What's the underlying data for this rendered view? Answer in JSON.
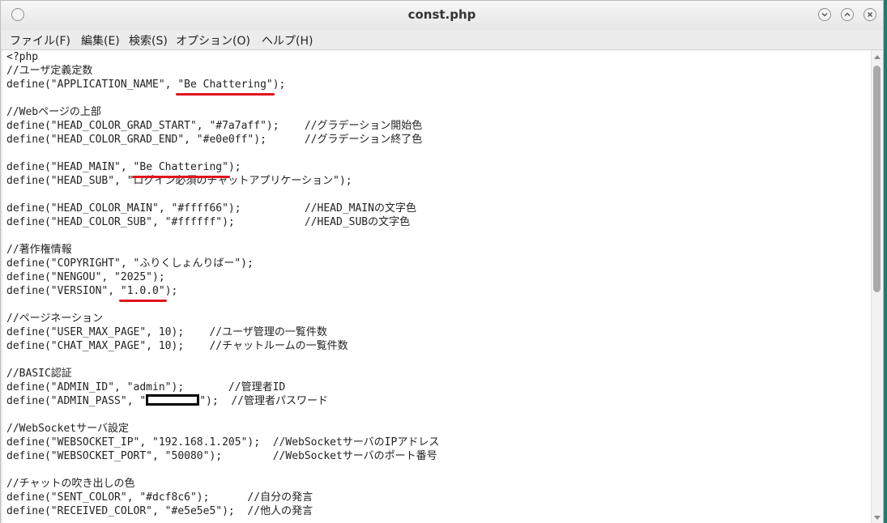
{
  "window": {
    "title": "const.php"
  },
  "menu": [
    "ファイル(F)",
    "編集(E)",
    "検索(S)",
    "オプション(O)",
    "ヘルプ(H)"
  ],
  "code_lines": [
    [
      "<?php"
    ],
    [
      "//ユーザ定義定数"
    ],
    [
      "define(\"APPLICATION_NAME\", ",
      "\"Be Chattering\"",
      ");"
    ],
    [
      ""
    ],
    [
      "//Webページの上部"
    ],
    [
      "define(\"HEAD_COLOR_GRAD_START\", \"#7a7aff\");    //グラデーション開始色"
    ],
    [
      "define(\"HEAD_COLOR_GRAD_END\", \"#e0e0ff\");      //グラデーション終了色"
    ],
    [
      ""
    ],
    [
      "define(\"HEAD_MAIN\", ",
      "\"Be Chattering\"",
      ");"
    ],
    [
      "define(\"HEAD_SUB\", \"ログイン必須のチャットアプリケーション\");"
    ],
    [
      ""
    ],
    [
      "define(\"HEAD_COLOR_MAIN\", \"#ffff66\");          //HEAD_MAINの文字色"
    ],
    [
      "define(\"HEAD_COLOR_SUB\", \"#ffffff\");           //HEAD_SUBの文字色"
    ],
    [
      ""
    ],
    [
      "//著作権情報"
    ],
    [
      "define(\"COPYRIGHT\", \"ふりくしょんりばー\");"
    ],
    [
      "define(\"NENGOU\", \"2025\");"
    ],
    [
      "define(\"VERSION\", ",
      "\"1.0.0\"",
      ");"
    ],
    [
      ""
    ],
    [
      "//ページネーション"
    ],
    [
      "define(\"USER_MAX_PAGE\", 10);    //ユーザ管理の一覧件数"
    ],
    [
      "define(\"CHAT_MAX_PAGE\", 10);    //チャットルームの一覧件数"
    ],
    [
      ""
    ],
    [
      "//BASIC認証"
    ],
    [
      "define(\"ADMIN_ID\", \"admin\");       //管理者ID"
    ],
    [
      "define(\"ADMIN_PASS\", \"",
      "REDACTED",
      "\");  //管理者パスワード"
    ],
    [
      ""
    ],
    [
      "//WebSocketサーバ設定"
    ],
    [
      "define(\"WEBSOCKET_IP\", \"192.168.1.205\");  //WebSocketサーバのIPアドレス"
    ],
    [
      "define(\"WEBSOCKET_PORT\", \"50080\");        //WebSocketサーバのポート番号"
    ],
    [
      ""
    ],
    [
      "//チャットの吹き出しの色"
    ],
    [
      "define(\"SENT_COLOR\", \"#dcf8c6\");      //自分の発言"
    ],
    [
      "define(\"RECEIVED_COLOR\", \"#e5e5e5\");  //他人の発言"
    ]
  ],
  "colors": {
    "underline": "#e0141e",
    "desktop": "#1f7a6e"
  }
}
